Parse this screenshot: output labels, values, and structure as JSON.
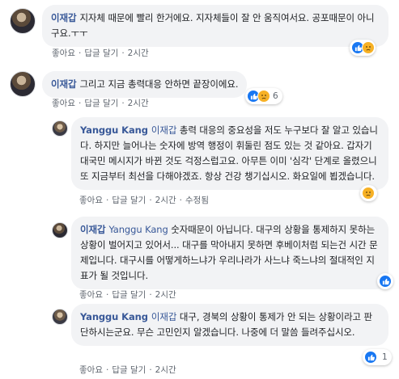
{
  "comments": [
    {
      "author": "이재갑",
      "text": "지자체 때문에 빨리 한거에요. 지자체들이 잘 안 움직여서요. 공포때문이 아니구요.ㅜㅜ",
      "actions": {
        "like": "좋아요",
        "reply": "답글 달기",
        "time": "2시간"
      },
      "reactions": {
        "count": ""
      }
    },
    {
      "author": "이재갑",
      "text": "그리고 지금 총력대응 안하면 끝장이에요.",
      "actions": {
        "like": "좋아요",
        "reply": "답글 달기",
        "time": "2시간"
      },
      "reactions": {
        "count": "6"
      }
    },
    {
      "author": "Yanggu Kang",
      "tag": "이재갑",
      "text": "총력 대응의 중요성을 저도 누구보다 잘 알고 있습니다. 하지만 늘어나는 숫자에 방역 행정이 휘둘린 점도 있는 것 같아요. 갑자기 대국민 메시지가 바뀐 것도 걱정스럽고요. 아무튼 이미 '심각' 단계로 올렸으니 또 지금부터 최선을 다해야겠죠. 항상 건강 챙기십시오. 화요일에 뵙겠습니다.",
      "actions": {
        "like": "좋아요",
        "reply": "답글 달기",
        "time": "2시간",
        "edited": "수정됨"
      },
      "reactions": {
        "count": ""
      }
    },
    {
      "author": "이재갑",
      "tag": "Yanggu Kang",
      "text": "숫자때문이 아닙니다. 대구의 상황을 통제하지 못하는 상황이 벌어지고 있어서... 대구를 막아내지 못하면 후베이처럼 되는건 시간 문제입니다. 대구시를 어떻게하느냐가 우리나라가 사느냐 죽느냐의 절대적인 지표가 될 것입니다.",
      "actions": {
        "like": "좋아요",
        "reply": "답글 달기",
        "time": "2시간"
      },
      "reactions": {
        "count": ""
      }
    },
    {
      "author": "Yanggu Kang",
      "tag": "이재갑",
      "text": "대구, 경북의 상황이 통제가 안 되는 상황이라고 판단하시는군요. 무슨 고민인지 알겠습니다. 나중에 더 말씀 들려주십시오.",
      "actions": {
        "like": "좋아요",
        "reply": "답글 달기",
        "time": "2시간"
      },
      "reactions": {
        "count": "1"
      }
    }
  ],
  "separator": "·",
  "colors": {
    "link": "#385898",
    "bubble": "#f2f3f5",
    "meta": "#606770",
    "like": "#1877f2",
    "sad": "#f7b125"
  }
}
